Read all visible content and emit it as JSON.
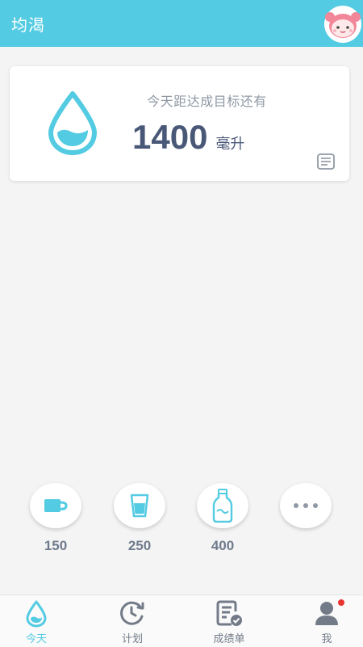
{
  "header": {
    "title": "均渴"
  },
  "goal_card": {
    "subtitle": "今天距达成目标还有",
    "remaining_value": "1400",
    "remaining_unit": "毫升"
  },
  "quick_add": [
    {
      "label": "150",
      "icon": "cup-icon"
    },
    {
      "label": "250",
      "icon": "glass-icon"
    },
    {
      "label": "400",
      "icon": "bottle-icon"
    },
    {
      "label": "",
      "icon": "more-icon"
    }
  ],
  "nav": {
    "items": [
      {
        "label": "今天",
        "icon": "water-drop-icon",
        "active": true
      },
      {
        "label": "计划",
        "icon": "clock-refresh-icon",
        "active": false
      },
      {
        "label": "成绩单",
        "icon": "report-check-icon",
        "active": false
      },
      {
        "label": "我",
        "icon": "user-icon",
        "active": false,
        "badge": true
      }
    ]
  },
  "colors": {
    "accent": "#53cbe2",
    "text_dark": "#4a5878",
    "text_muted": "#8f98a4",
    "badge": "#e8332e"
  }
}
